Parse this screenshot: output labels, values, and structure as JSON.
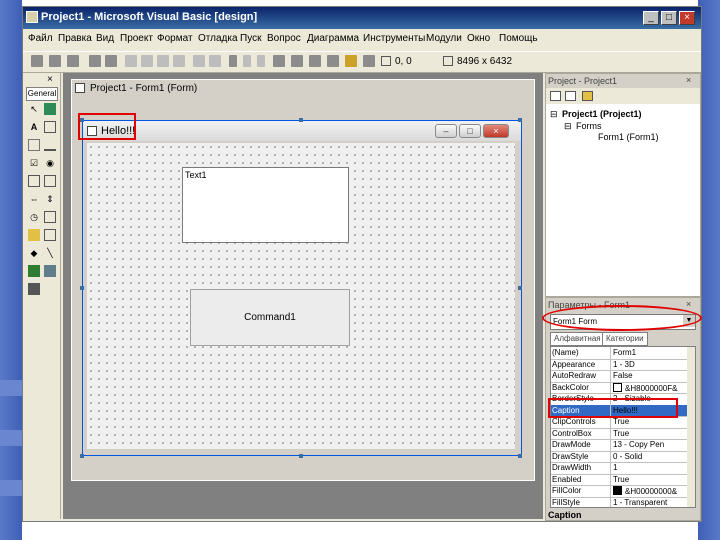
{
  "app": {
    "title": "Project1 - Microsoft Visual Basic [design]"
  },
  "menu": [
    "Файл",
    "Правка",
    "Вид",
    "Проект",
    "Формат",
    "Отладка",
    "Пуск",
    "Вопрос",
    "Диаграмма",
    "Инструменты",
    "Модули",
    "Окно",
    "Помощь"
  ],
  "toolbar": {
    "position": "0, 0",
    "size": "8496 x 6432"
  },
  "toolbox": {
    "tab_label": "General"
  },
  "designer": {
    "title": "Project1 - Form1 (Form)"
  },
  "form": {
    "caption": "Hello!!!",
    "textbox_text": "Text1",
    "button_caption": "Command1"
  },
  "project_explorer": {
    "title": "Project - Project1",
    "root": "Project1 (Project1)",
    "folder": "Forms",
    "item": "Form1 (Form1)"
  },
  "properties": {
    "title": "Параметры - Form1",
    "object": "Form1  Form",
    "tabs": [
      "Алфавитная",
      "Категории"
    ],
    "rows": [
      {
        "name": "(Name)",
        "value": "Form1"
      },
      {
        "name": "Appearance",
        "value": "1 - 3D"
      },
      {
        "name": "AutoRedraw",
        "value": "False"
      },
      {
        "name": "BackColor",
        "value": "&H8000000F&",
        "swatch": "#ffffff"
      },
      {
        "name": "BorderStyle",
        "value": "2 - Sizable"
      },
      {
        "name": "Caption",
        "value": "Hello!!!"
      },
      {
        "name": "ClipControls",
        "value": "True"
      },
      {
        "name": "ControlBox",
        "value": "True"
      },
      {
        "name": "DrawMode",
        "value": "13 - Copy Pen"
      },
      {
        "name": "DrawStyle",
        "value": "0 - Solid"
      },
      {
        "name": "DrawWidth",
        "value": "1"
      },
      {
        "name": "Enabled",
        "value": "True"
      },
      {
        "name": "FillColor",
        "value": "&H00000000&",
        "swatch": "#000000"
      },
      {
        "name": "FillStyle",
        "value": "1 - Transparent"
      }
    ],
    "selected_row": "Caption",
    "footer": "Caption"
  },
  "colors": {
    "highlight": "#e00000",
    "title_bar": "#0a246a",
    "selection": "#316ac5"
  }
}
